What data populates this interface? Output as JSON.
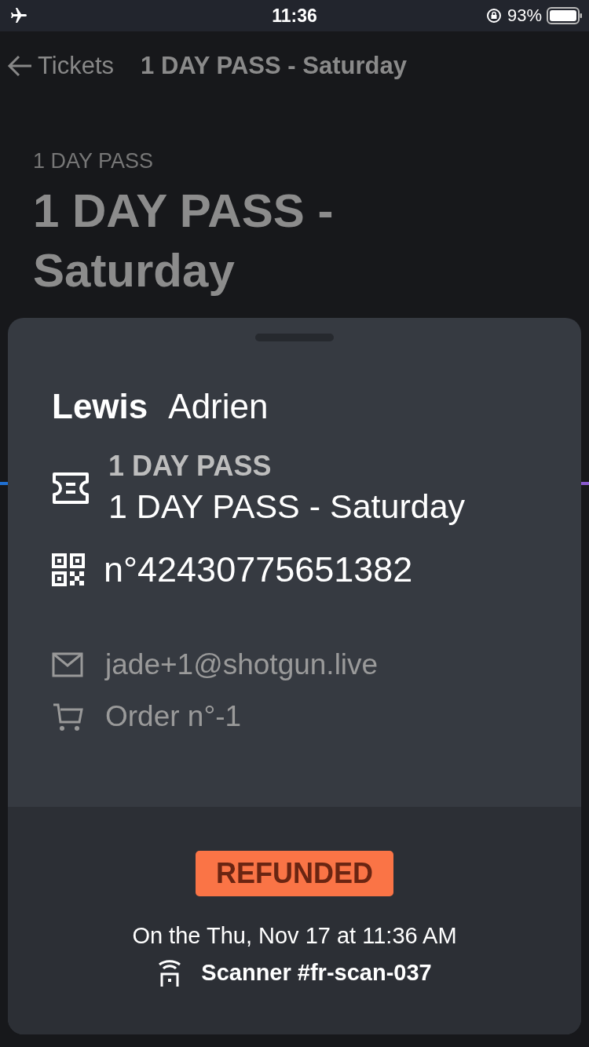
{
  "status_bar": {
    "time": "11:36",
    "battery": "93%"
  },
  "nav": {
    "back_label": "Tickets",
    "title": "1 DAY PASS - Saturday"
  },
  "header": {
    "category": "1 DAY PASS",
    "title": "1 DAY PASS - Saturday"
  },
  "sheet": {
    "last_name": "Lewis",
    "first_name": "Adrien",
    "ticket": {
      "category": "1 DAY PASS",
      "name": "1 DAY PASS - Saturday"
    },
    "ticket_number": "n°42430775651382",
    "email": "jade+1@shotgun.live",
    "order": "Order n°-1",
    "status": {
      "label": "REFUNDED",
      "kind": "refunded"
    },
    "scan_time": "On the Thu, Nov 17 at 11:36 AM",
    "scanner": "Scanner #fr-scan-037"
  }
}
